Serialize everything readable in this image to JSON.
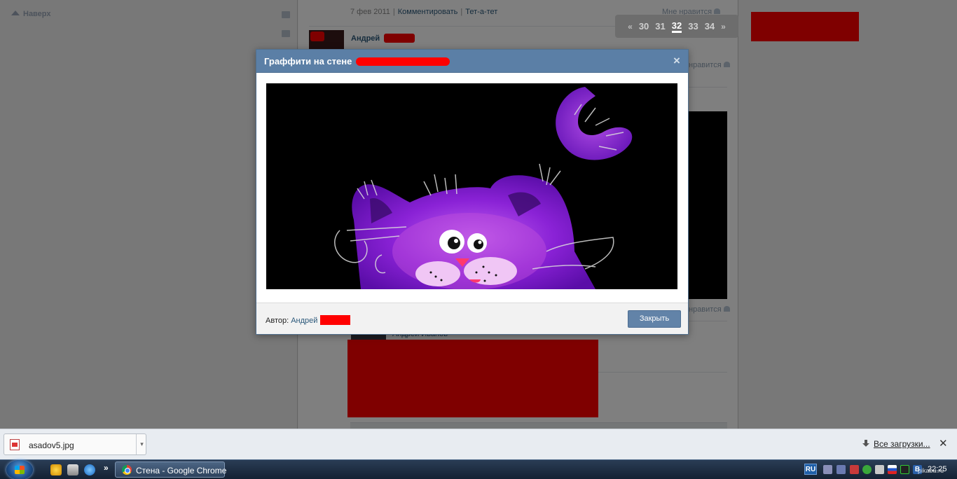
{
  "page": {
    "up_link": "Наверх",
    "post_meta": {
      "date": "7 фев 2011",
      "comment_link": "Комментировать",
      "tete_link": "Тет-а-тет"
    },
    "like_label": "Мне нравится",
    "like_label_partial": "нравится",
    "post_author": "Андрей",
    "bottom_name": "Андрей Иванов"
  },
  "pager": {
    "prev": "«",
    "pages": [
      "30",
      "31",
      "32",
      "33",
      "34"
    ],
    "active": "32",
    "next": "»"
  },
  "modal": {
    "title": "Граффити на стене",
    "author_label": "Автор:",
    "author_name": "Андрей",
    "close_button": "Закрыть"
  },
  "downloads": {
    "file_name": "asadov5.jpg",
    "all_downloads": "Все загрузки..."
  },
  "taskbar": {
    "quicklaunch_more": "»",
    "task_label": "Стена - Google Chrome",
    "language": "RU",
    "clock": "22:25"
  },
  "watermark": "pikabu.ru",
  "colors": {
    "vk_header": "#5b7fa6",
    "vk_link": "#2b587a",
    "button_blue": "#6283a8",
    "redaction": "#ff0000",
    "cat_purple": "#9a2bd8"
  },
  "icons": [
    "mail-icon",
    "comment-icon",
    "heart-icon",
    "close-icon",
    "file-image-icon",
    "download-icon",
    "start-orb-icon",
    "chrome-icon",
    "ie-icon"
  ]
}
